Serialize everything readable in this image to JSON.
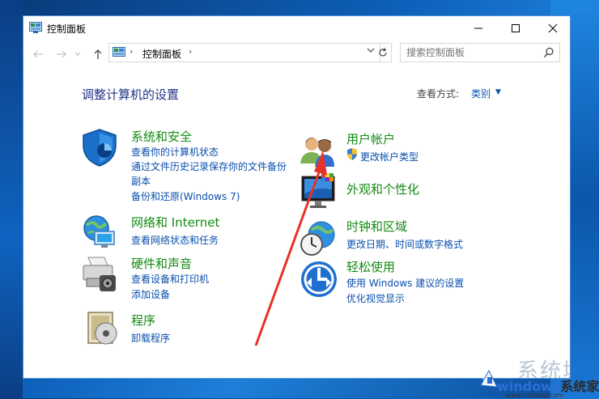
{
  "window": {
    "title": "控制面板"
  },
  "nav": {
    "address_text": "控制面板",
    "search_placeholder": "搜索控制面板"
  },
  "main": {
    "heading": "调整计算机的设置",
    "view_by_label": "查看方式:",
    "view_by_value": "类别"
  },
  "categories": [
    {
      "title": "系统和安全",
      "icon": "shield-icon",
      "links": [
        "查看你的计算机状态",
        "通过文件历史记录保存你的文件备份",
        "副本",
        "备份和还原(Windows 7)"
      ]
    },
    {
      "title": "网络和 Internet",
      "icon": "network-globe-icon",
      "links": [
        "查看网络状态和任务"
      ]
    },
    {
      "title": "硬件和声音",
      "icon": "printer-icon",
      "links": [
        "查看设备和打印机",
        "添加设备"
      ]
    },
    {
      "title": "程序",
      "icon": "programs-icon",
      "links": [
        "卸载程序"
      ]
    },
    {
      "title": "用户帐户",
      "icon": "users-icon",
      "links": [
        "更改帐户类型"
      ]
    },
    {
      "title": "外观和个性化",
      "icon": "appearance-icon",
      "links": []
    },
    {
      "title": "时钟和区域",
      "icon": "clock-globe-icon",
      "links": [
        "更改日期、时间或数字格式"
      ]
    },
    {
      "title": "轻松使用",
      "icon": "ease-of-access-icon",
      "links": [
        "使用 Windows 建议的设置",
        "优化视觉显示"
      ]
    }
  ],
  "watermark": {
    "brand_a": "windows",
    "brand_b": "系统家园",
    "url": "www.ruinaitu.com",
    "overlay": "系统城"
  },
  "colors": {
    "category_title": "#128a12",
    "link": "#0a4fae",
    "heading": "#1e3287",
    "annotation_arrow": "#e5332a"
  }
}
